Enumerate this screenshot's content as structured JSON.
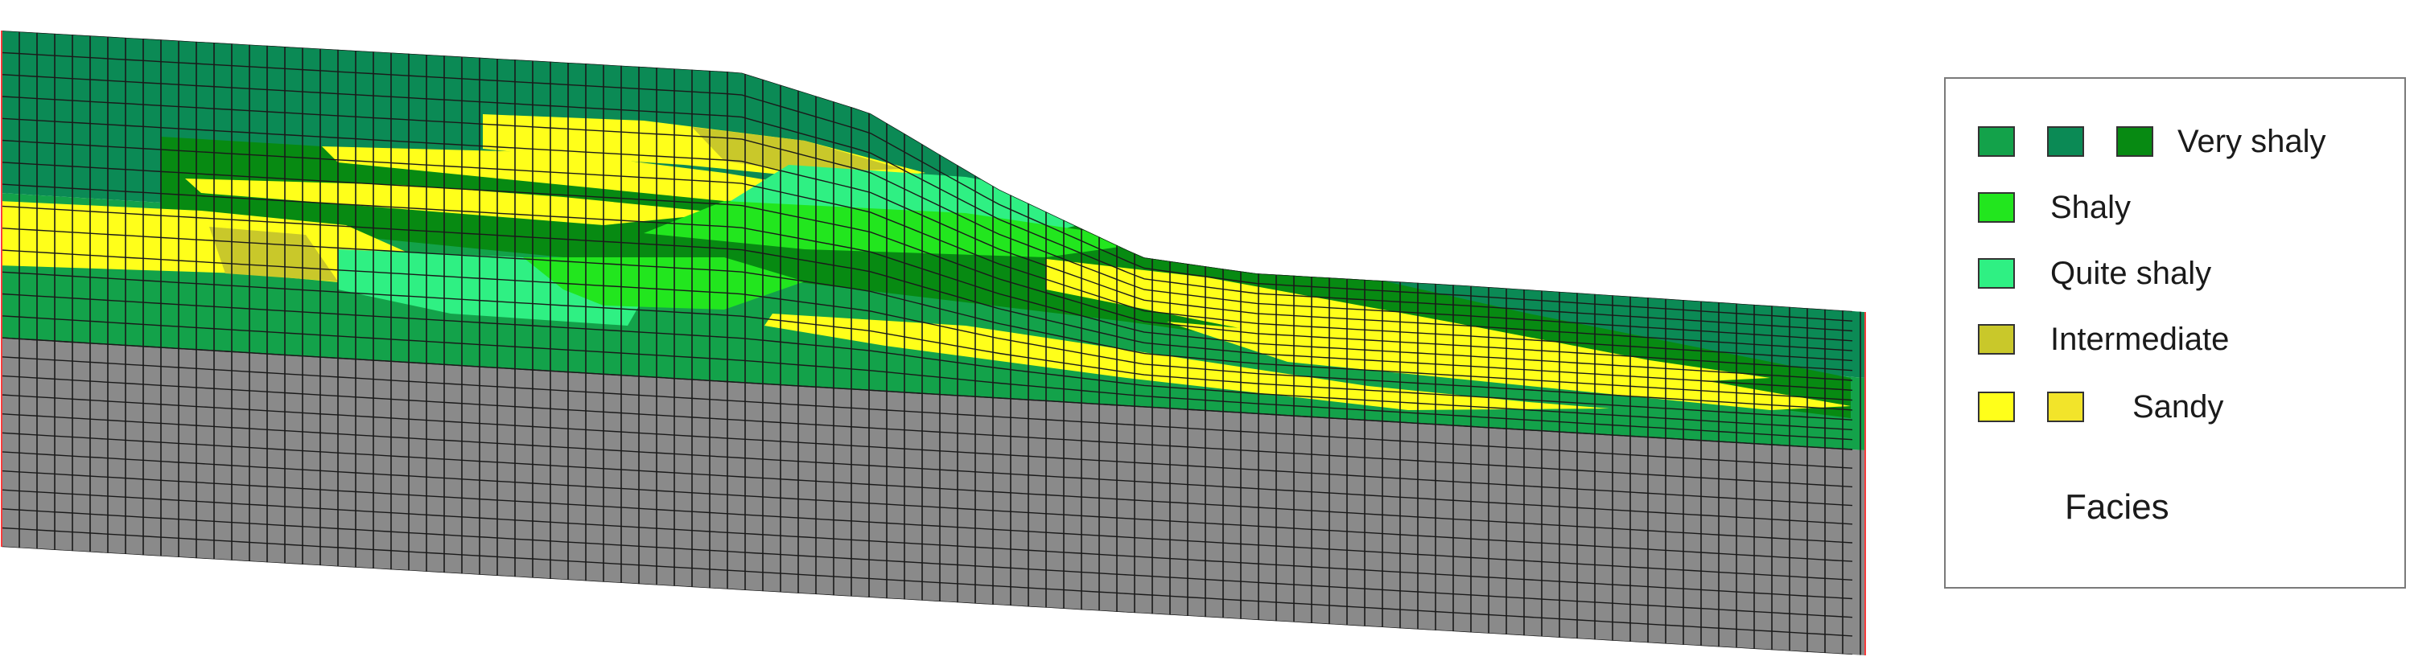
{
  "colors": {
    "very_shaly_1": "#13a24a",
    "very_shaly_2": "#0b8a55",
    "very_shaly_3": "#078a12",
    "shaly": "#22e61e",
    "quite_shaly": "#2ff083",
    "intermediate": "#c9c82a",
    "sandy_1": "#ffff1a",
    "sandy_2": "#f2e42a",
    "basement": "#8a8a8a",
    "grid_line": "#1a1a1a",
    "edge_line": "#ff3b3b"
  },
  "legend": {
    "title": "Facies",
    "items": [
      {
        "label": "Very shaly",
        "swatches": [
          "very_shaly_1",
          "very_shaly_2",
          "very_shaly_3"
        ]
      },
      {
        "label": "Shaly",
        "swatches": [
          "shaly"
        ]
      },
      {
        "label": "Quite shaly",
        "swatches": [
          "quite_shaly"
        ]
      },
      {
        "label": "Intermediate",
        "swatches": [
          "intermediate"
        ]
      },
      {
        "label": "Sandy",
        "swatches": [
          "sandy_1",
          "sandy_2"
        ]
      }
    ]
  }
}
